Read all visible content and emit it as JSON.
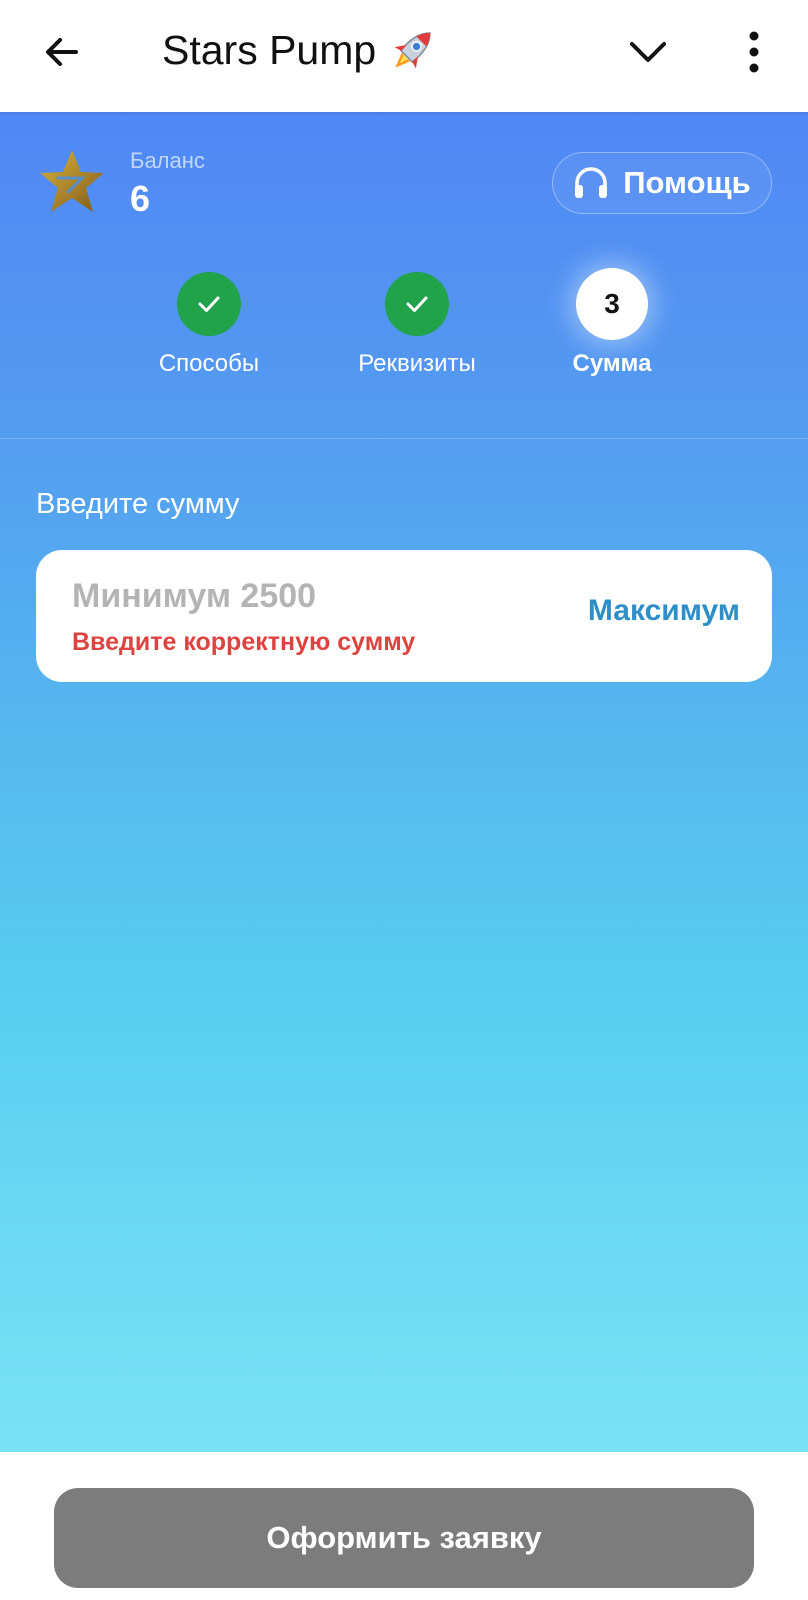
{
  "header": {
    "title": "Stars Pump",
    "back_icon": "arrow-left-icon",
    "title_icon": "rocket-icon",
    "collapse_icon": "chevron-down-icon",
    "menu_icon": "more-vertical-icon"
  },
  "balance": {
    "label": "Баланс",
    "value": "6",
    "icon": "star-icon"
  },
  "help": {
    "label": "Помощь",
    "icon": "headphones-icon"
  },
  "steps": [
    {
      "label": "Способы",
      "status": "done",
      "icon": "check-icon"
    },
    {
      "label": "Реквизиты",
      "status": "done",
      "icon": "check-icon"
    },
    {
      "label": "Сумма",
      "status": "active",
      "number": "3"
    }
  ],
  "amount": {
    "title": "Введите сумму",
    "placeholder": "Минимум 2500",
    "value": "",
    "error": "Введите корректную сумму",
    "max_label": "Максимум"
  },
  "submit": {
    "label": "Оформить заявку"
  },
  "colors": {
    "accent_blue": "#2e8fc8",
    "success_green": "#21a34a",
    "error_red": "#dd4440",
    "disabled_gray": "#7c7c7c",
    "gradient_top": "#5088f5",
    "gradient_bottom": "#78e2f6"
  }
}
